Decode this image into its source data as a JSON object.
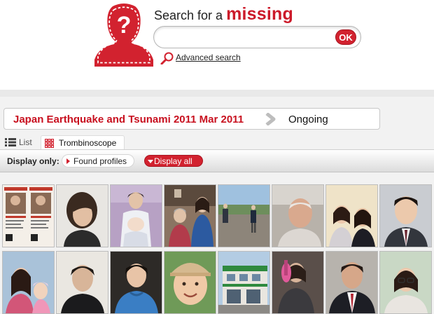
{
  "header": {
    "search_prefix": "Search for a",
    "search_highlight": "missing",
    "search_value": "",
    "ok_label": "OK",
    "advanced_search": "Advanced search",
    "logo_icon": "missing-person-icon",
    "accent_color": "#cc1a2a"
  },
  "event": {
    "title": "Japan Earthquake and Tsunami 2011 Mar 2011",
    "status": "Ongoing"
  },
  "tabs": [
    {
      "label": "List",
      "icon": "list-icon",
      "active": false
    },
    {
      "label": "Trombinoscope",
      "icon": "grid-icon",
      "active": true
    }
  ],
  "filter": {
    "label": "Display only:",
    "found_profiles": "Found profiles",
    "display_all": "Display all"
  },
  "profiles": [
    {
      "row": 1,
      "col": 1,
      "subject": "flyer"
    },
    {
      "row": 1,
      "col": 2,
      "subject": "person"
    },
    {
      "row": 1,
      "col": 3,
      "subject": "person-with-baby"
    },
    {
      "row": 1,
      "col": 4,
      "subject": "group"
    },
    {
      "row": 1,
      "col": 5,
      "subject": "outdoor"
    },
    {
      "row": 1,
      "col": 6,
      "subject": "person"
    },
    {
      "row": 1,
      "col": 7,
      "subject": "group"
    },
    {
      "row": 1,
      "col": 8,
      "subject": "person"
    },
    {
      "row": 2,
      "col": 1,
      "subject": "group"
    },
    {
      "row": 2,
      "col": 2,
      "subject": "person"
    },
    {
      "row": 2,
      "col": 3,
      "subject": "person"
    },
    {
      "row": 2,
      "col": 4,
      "subject": "child"
    },
    {
      "row": 2,
      "col": 5,
      "subject": "building"
    },
    {
      "row": 2,
      "col": 6,
      "subject": "person-with-guitar"
    },
    {
      "row": 2,
      "col": 7,
      "subject": "person"
    },
    {
      "row": 2,
      "col": 8,
      "subject": "person"
    }
  ]
}
